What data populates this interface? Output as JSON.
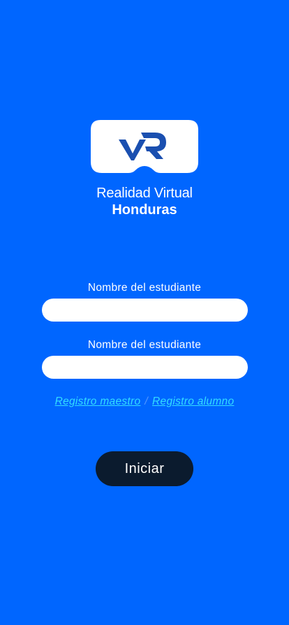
{
  "brand": {
    "line1": "Realidad Virtual",
    "line2": "Honduras",
    "logo_icon": "vr-headset-logo-icon",
    "logo_color": "#1A4FB0"
  },
  "form": {
    "field1_label": "Nombre del estudiante",
    "field1_value": "",
    "field2_label": "Nombre del estudiante",
    "field2_value": ""
  },
  "links": {
    "teacher_register": "Registro maestro",
    "separator": "/",
    "student_register": "Registro alumno"
  },
  "actions": {
    "start_label": "Iniciar"
  },
  "colors": {
    "background": "#0066FF",
    "link": "#33DDFF",
    "button": "#0B1B2E"
  }
}
